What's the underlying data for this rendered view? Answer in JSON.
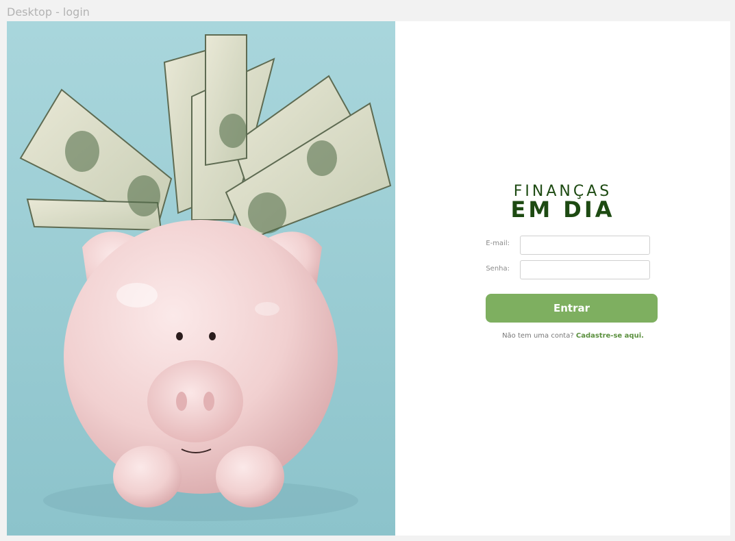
{
  "frame": {
    "label": "Desktop - login"
  },
  "colors": {
    "background": "#f2f2f2",
    "photo_background": "#a4d3d9",
    "brand_green": "#1d4a12",
    "button_green": "#7eaf60",
    "link_green": "#5a8f3d"
  },
  "hero_image": {
    "description_icon": "piggy-bank-with-dollar-bills-image"
  },
  "logo": {
    "line1": "FINANÇAS",
    "line2": "EM DIA"
  },
  "form": {
    "email_label": "E-mail:",
    "email_value": "",
    "password_label": "Senha:",
    "password_value": "",
    "submit_label": "Entrar"
  },
  "signup": {
    "prompt": "Não tem uma conta?",
    "link_text": "Cadastre-se aqui."
  }
}
